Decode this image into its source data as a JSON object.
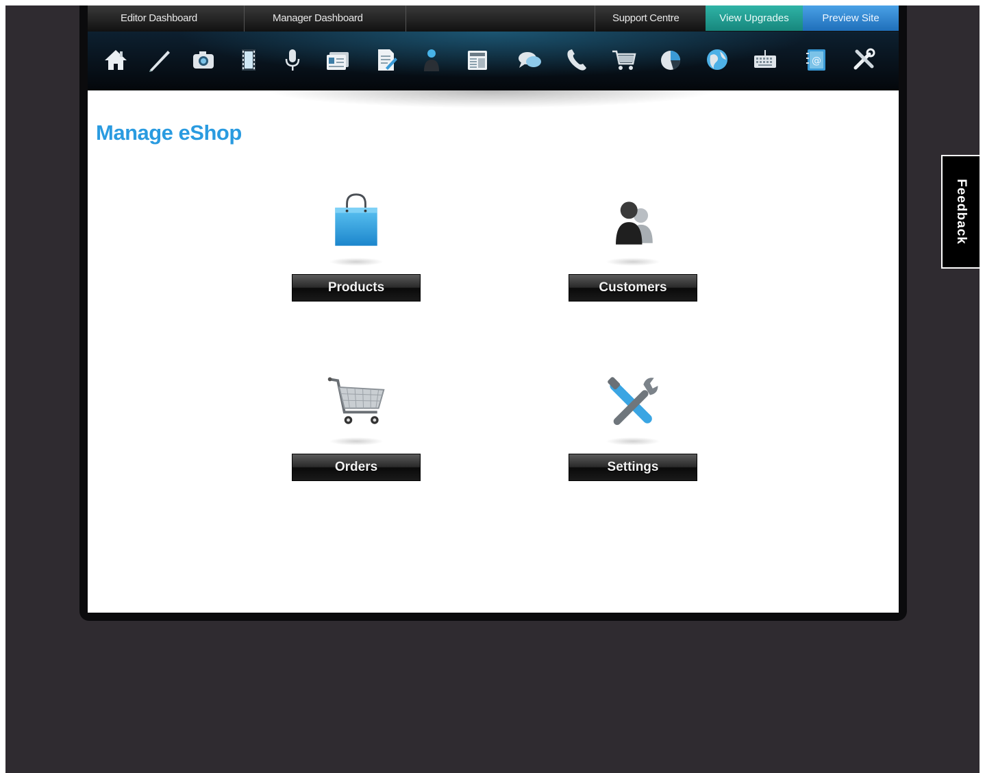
{
  "topnav": {
    "editor_dashboard": "Editor Dashboard",
    "manager_dashboard": "Manager Dashboard",
    "support_centre": "Support Centre",
    "view_upgrades": "View Upgrades",
    "preview_site": "Preview Site"
  },
  "toolbar": {
    "icons": [
      "home-icon",
      "pen-icon",
      "camera-icon",
      "film-icon",
      "microphone-icon",
      "id-card-icon",
      "document-edit-icon",
      "user-profile-icon",
      "newspaper-icon",
      "chat-icon",
      "phone-icon",
      "shopping-cart-icon",
      "pie-chart-icon",
      "globe-icon",
      "keyboard-icon",
      "address-book-icon",
      "settings-tools-icon"
    ]
  },
  "page": {
    "title": "Manage eShop"
  },
  "tiles": {
    "products": "Products",
    "customers": "Customers",
    "orders": "Orders",
    "settings": "Settings"
  },
  "feedback": {
    "label": "Feedback"
  },
  "colors": {
    "accent": "#2a9be0",
    "upgrades": "#1f9e92",
    "preview": "#2f86d6",
    "background": "#2f2b30"
  }
}
